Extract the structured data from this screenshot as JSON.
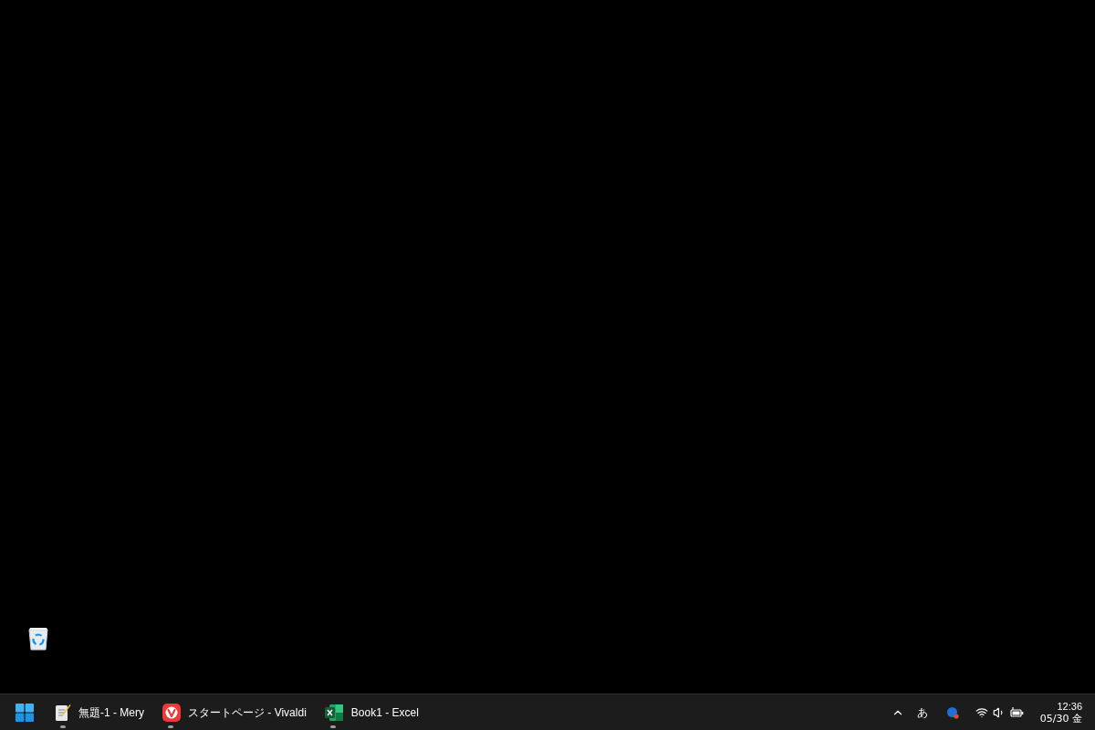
{
  "taskbar": {
    "apps": [
      {
        "kind": "notepad",
        "label": "無題-1 - Mery",
        "running": true
      },
      {
        "kind": "browser",
        "label": "スタートページ - Vivaldi",
        "running": true
      },
      {
        "kind": "spreadsheet",
        "label": "Book1 - Excel",
        "running": true
      }
    ],
    "tray": {
      "ime": "あ"
    },
    "clock": {
      "time": "12:36",
      "date": "05/30 金"
    }
  }
}
